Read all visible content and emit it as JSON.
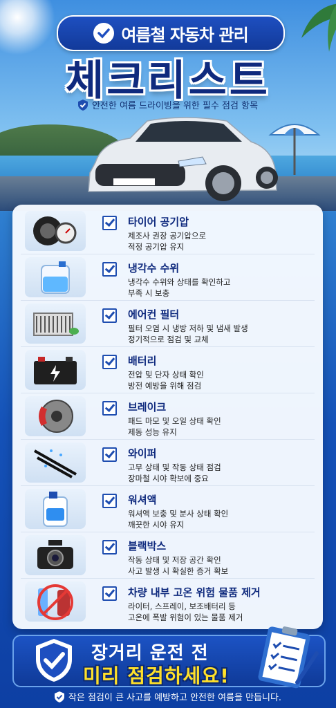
{
  "header": {
    "pill_text": "여름철 자동차 관리",
    "title": "체크리스트",
    "subtitle": "안전한 여름 드라이빙을 위한 필수 점검 항목"
  },
  "items": [
    {
      "icon": "tire-gauge-icon",
      "title": "타이어 공기압",
      "desc1": "제조사 권장 공기압으로",
      "desc2": "적정 공기압 유지"
    },
    {
      "icon": "coolant-icon",
      "title": "냉각수 수위",
      "desc1": "냉각수 수위와 상태를 확인하고",
      "desc2": "부족 시 보충"
    },
    {
      "icon": "air-filter-icon",
      "title": "에어컨 필터",
      "desc1": "필터 오염 시 냉방 저하 및 냄새 발생",
      "desc2": "정기적으로 점검 및 교체"
    },
    {
      "icon": "battery-icon",
      "title": "배터리",
      "desc1": "전압 및 단자 상태 확인",
      "desc2": "방전 예방을 위해 점검"
    },
    {
      "icon": "brake-icon",
      "title": "브레이크",
      "desc1": "패드 마모 및 오일 상태 확인",
      "desc2": "제동 성능 유지"
    },
    {
      "icon": "wiper-icon",
      "title": "와이퍼",
      "desc1": "고무 상태 및 작동 상태 점검",
      "desc2": "장마철 시야 확보에 중요"
    },
    {
      "icon": "washer-fluid-icon",
      "title": "워셔액",
      "desc1": "워셔액 보충 및 분사 상태 확인",
      "desc2": "깨끗한 시야 유지"
    },
    {
      "icon": "dashcam-icon",
      "title": "블랙박스",
      "desc1": "작동 상태 및 저장 공간 확인",
      "desc2": "사고 발생 시 확실한 증거 확보"
    },
    {
      "icon": "hazard-items-icon",
      "title": "차량 내부 고온 위험 물품 제거",
      "desc1": "라이터, 스프레이, 보조배터리 등",
      "desc2": "고온에 폭발 위험이 있는 물품 제거"
    }
  ],
  "banner": {
    "line1": "장거리 운전 전",
    "line2": "미리 점검하세요!"
  },
  "footer": {
    "text": "작은 점검이 큰 사고를 예방하고 안전한 여름을 만듭니다."
  },
  "colors": {
    "navy": "#0f2a7e",
    "blue": "#1e4db0",
    "yellow": "#ffe02a"
  }
}
